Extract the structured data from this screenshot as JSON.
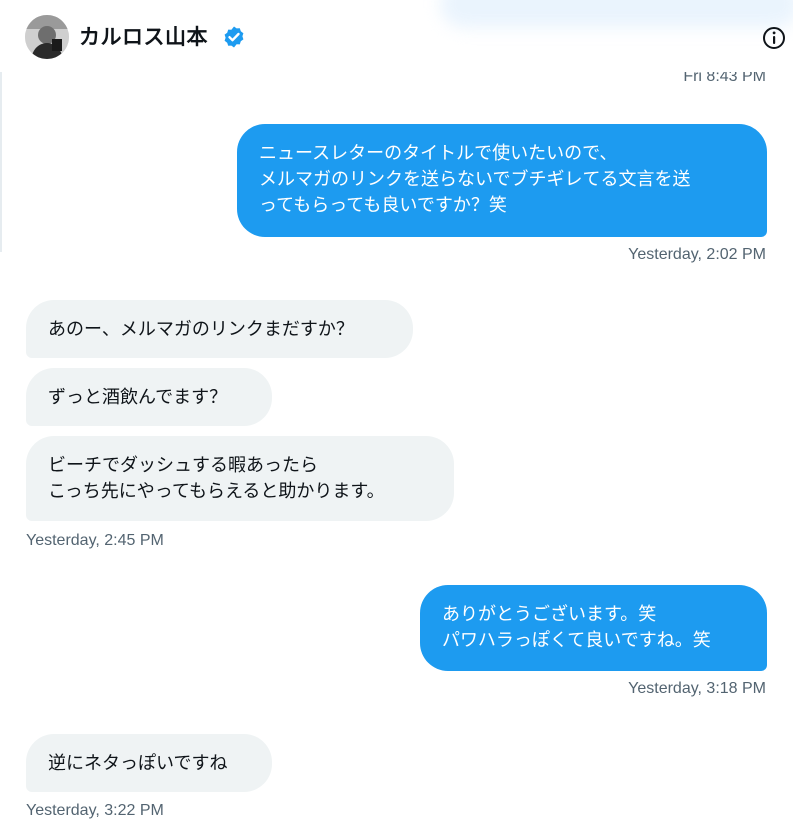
{
  "conversation": {
    "contact_name": "カルロス山本",
    "avatar_icon": "profile-photo",
    "verified_icon": "verified-badge-icon",
    "info_icon": "info-icon",
    "accent_color": "#1d9bf0"
  },
  "messages": [
    {
      "direction": "timestamp",
      "text": "Fri 8:43 PM"
    },
    {
      "direction": "outgoing",
      "text": "ニュースレターのタイトルで使いたいので、\nメルマガのリンクを送らないでブチギレてる文言を送\nってもらっても良いですか？笑"
    },
    {
      "direction": "timestamp",
      "text": "Yesterday, 2:02 PM"
    },
    {
      "direction": "incoming",
      "text": "あのー、メルマガのリンクまだすか？"
    },
    {
      "direction": "incoming",
      "text": "ずっと酒飲んでます？"
    },
    {
      "direction": "incoming",
      "text": "ビーチでダッシュする暇あったら\nこっち先にやってもらえると助かります。"
    },
    {
      "direction": "timestamp",
      "text": "Yesterday, 2:45 PM"
    },
    {
      "direction": "outgoing",
      "text": "ありがとうございます。笑\nパワハラっぽくて良いですね。笑"
    },
    {
      "direction": "timestamp",
      "text": "Yesterday, 3:18 PM"
    },
    {
      "direction": "incoming",
      "text": "逆にネタっぽいですね"
    },
    {
      "direction": "timestamp",
      "text": "Yesterday, 3:22 PM"
    }
  ]
}
